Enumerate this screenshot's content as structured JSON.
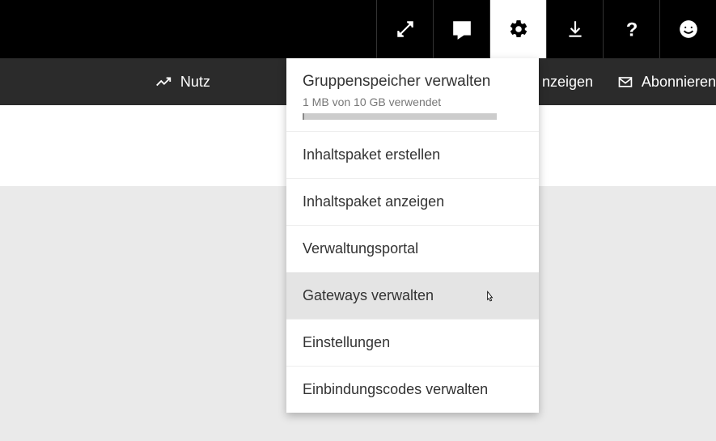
{
  "topbar": {
    "items": [
      {
        "name": "fullscreen-icon"
      },
      {
        "name": "feedback-icon"
      },
      {
        "name": "gear-icon",
        "active": true
      },
      {
        "name": "download-icon"
      },
      {
        "name": "help-icon"
      },
      {
        "name": "smiley-icon"
      }
    ]
  },
  "secondbar": {
    "usage_label": "Nutz",
    "view_label": "nzeigen",
    "subscribe_label": "Abonnieren"
  },
  "dropdown": {
    "storage": {
      "title": "Gruppenspeicher verwalten",
      "subtitle": "1 MB von 10 GB verwendet"
    },
    "items": [
      {
        "label": "Inhaltspaket erstellen"
      },
      {
        "label": "Inhaltspaket anzeigen"
      },
      {
        "label": "Verwaltungsportal"
      },
      {
        "label": "Gateways verwalten",
        "hovered": true
      },
      {
        "label": "Einstellungen"
      },
      {
        "label": "Einbindungscodes verwalten"
      }
    ]
  }
}
